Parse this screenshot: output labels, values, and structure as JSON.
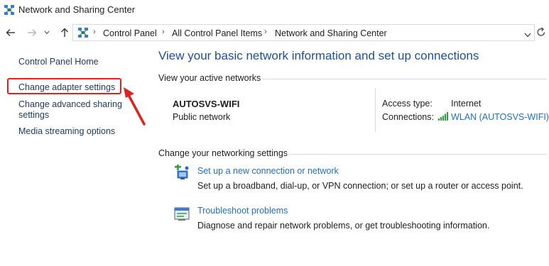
{
  "window": {
    "title": "Network and Sharing Center"
  },
  "address_bar": {
    "crumbs": [
      "Control Panel",
      "All Control Panel Items",
      "Network and Sharing Center"
    ]
  },
  "left_pane": {
    "links": [
      "Control Panel Home",
      "Change adapter settings",
      "Change advanced sharing",
      "settings",
      "Media streaming options"
    ]
  },
  "main": {
    "title": "View your basic network information and set up connections",
    "active_networks_label": "View your active networks",
    "network": {
      "name": "AUTOSVS-WIFI",
      "category": "Public network",
      "access_type_label": "Access type:",
      "access_type_value": "Internet",
      "connections_label": "Connections:",
      "connections_value": "WLAN (AUTOSVS-WIFI)"
    },
    "change_settings_label": "Change your networking settings",
    "tasks": [
      {
        "link": "Set up a new connection or network",
        "description": "Set up a broadband, dial-up, or VPN connection; or set up a router or access point."
      },
      {
        "link": "Troubleshoot problems",
        "description": "Diagnose and repair network problems, or get troubleshooting information."
      }
    ]
  },
  "colors": {
    "link_blue": "#1f6fc5",
    "title_blue": "#1e4f9b",
    "annotation_red": "#e0221c"
  },
  "icons": {
    "title": "network-center-icon",
    "back": "back-arrow-icon",
    "forward": "forward-arrow-icon",
    "recent": "chevron-down-icon",
    "up": "up-arrow-icon",
    "address": "network-center-icon",
    "refresh": "refresh-icon",
    "wifi": "wifi-signal-icon",
    "new_connection": "new-connection-icon",
    "troubleshoot": "troubleshoot-icon"
  }
}
